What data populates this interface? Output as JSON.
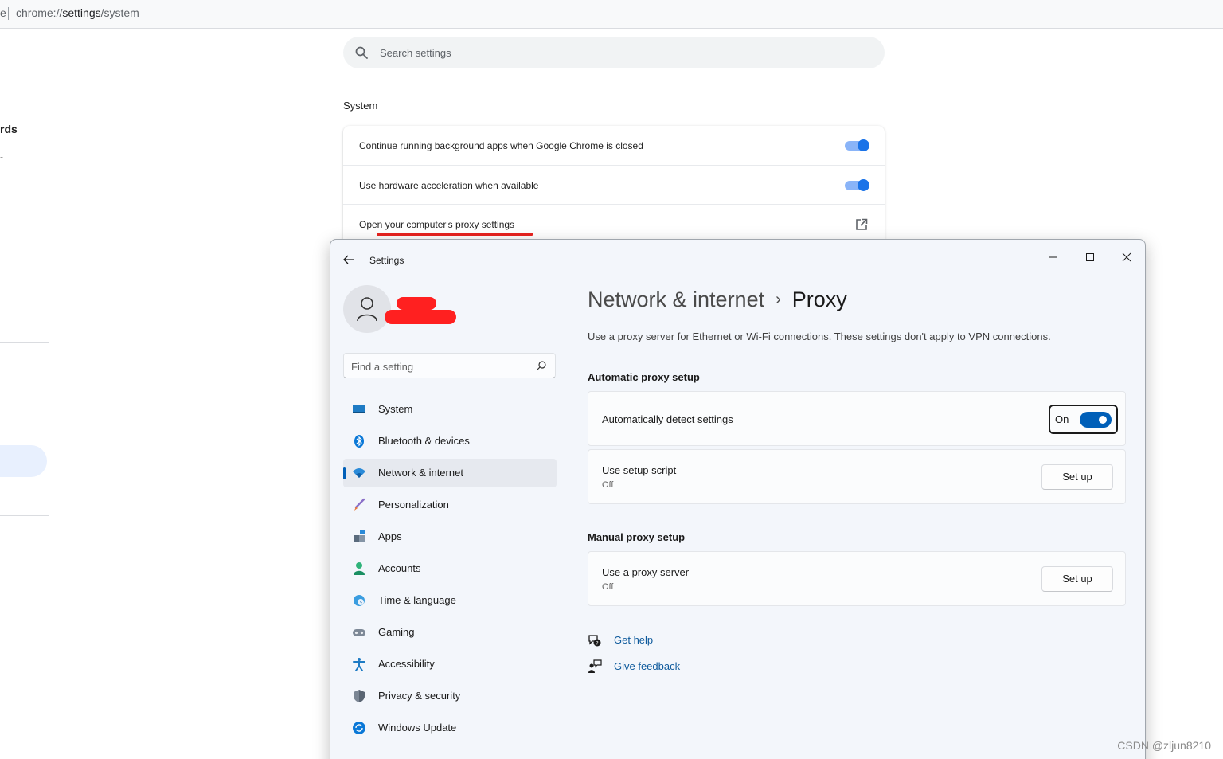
{
  "chrome": {
    "address_edge": "e",
    "url_scheme": "chrome://",
    "url_host": "settings",
    "url_path": "/system",
    "left_fragment_1": "rds",
    "left_fragment_2": "-",
    "search_placeholder": "Search settings",
    "section_title": "System",
    "rows": [
      {
        "label": "Continue running background apps when Google Chrome is closed",
        "control": "toggle",
        "checked": true
      },
      {
        "label": "Use hardware acceleration when available",
        "control": "toggle",
        "checked": true
      },
      {
        "label": "Open your computer's proxy settings",
        "control": "external-link-icon"
      }
    ],
    "accent": "#1a73e8",
    "highlight_color": "#e8231f"
  },
  "win": {
    "title": "Settings",
    "find_placeholder": "Find a setting",
    "nav": [
      {
        "label": "System",
        "icon": "monitor-icon"
      },
      {
        "label": "Bluetooth & devices",
        "icon": "bluetooth-icon"
      },
      {
        "label": "Network & internet",
        "icon": "wifi-icon",
        "active": true
      },
      {
        "label": "Personalization",
        "icon": "brush-icon"
      },
      {
        "label": "Apps",
        "icon": "apps-icon"
      },
      {
        "label": "Accounts",
        "icon": "person-icon"
      },
      {
        "label": "Time & language",
        "icon": "globe-clock-icon"
      },
      {
        "label": "Gaming",
        "icon": "gamepad-icon"
      },
      {
        "label": "Accessibility",
        "icon": "accessibility-icon"
      },
      {
        "label": "Privacy & security",
        "icon": "shield-icon"
      },
      {
        "label": "Windows Update",
        "icon": "update-icon"
      }
    ],
    "breadcrumb_parent": "Network & internet",
    "breadcrumb_sep": "›",
    "breadcrumb_current": "Proxy",
    "description": "Use a proxy server for Ethernet or Wi-Fi connections. These settings don't apply to VPN connections.",
    "auto_section": "Automatic proxy setup",
    "auto_detect_label": "Automatically detect settings",
    "auto_detect_state": "On",
    "setup_script_label": "Use setup script",
    "setup_script_state": "Off",
    "setup_button": "Set up",
    "manual_section": "Manual proxy setup",
    "proxy_server_label": "Use a proxy server",
    "proxy_server_state": "Off",
    "get_help": "Get help",
    "give_feedback": "Give feedback",
    "accent": "#005fb8"
  },
  "watermark": "CSDN @zljun8210"
}
